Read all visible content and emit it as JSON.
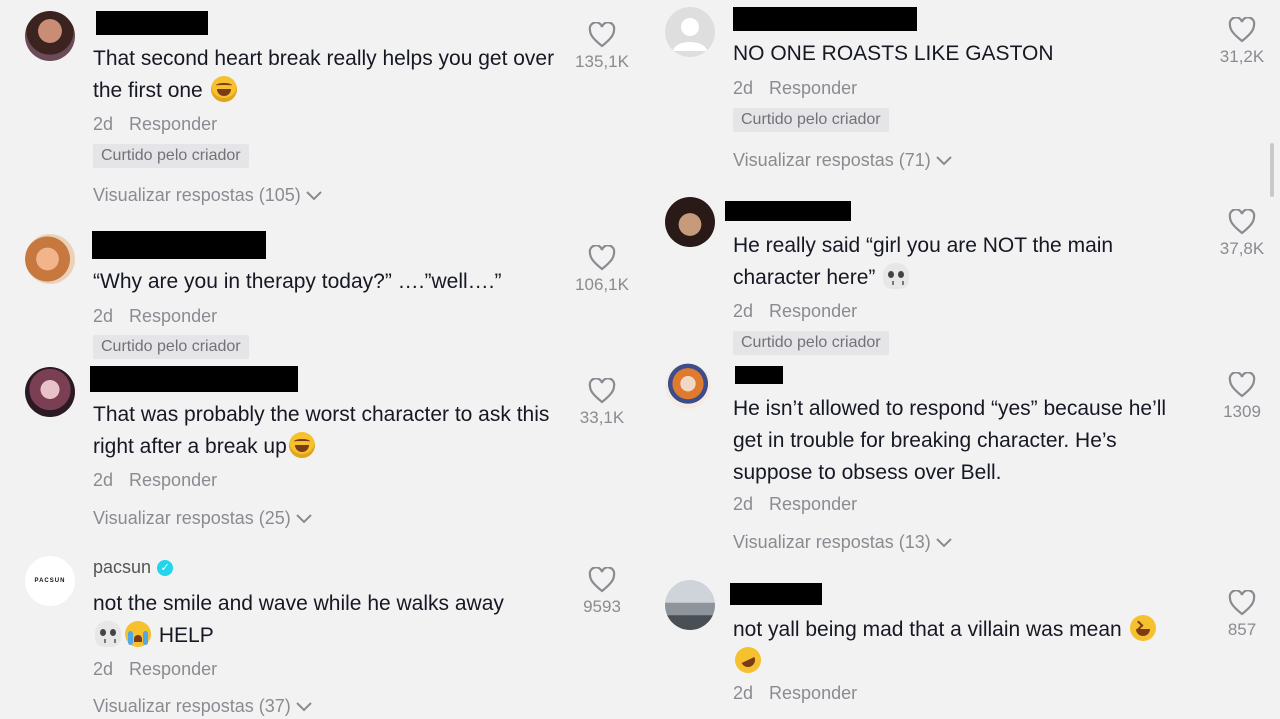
{
  "ui": {
    "reply_label": "Responder",
    "liked_by_creator": "Curtido pelo criador"
  },
  "comments_left": [
    {
      "text": "That second heart break really helps you get over the first one",
      "emoji": "laugh",
      "time": "2d",
      "likes": "135,1K",
      "view_replies": "Visualizar respostas (105)"
    },
    {
      "text": "“Why are you in therapy today?” ….”well….”",
      "time": "2d",
      "likes": "106,1K"
    },
    {
      "text": "That was probably the worst character to ask this right after a break up",
      "emoji": "laugh",
      "time": "2d",
      "likes": "33,1K",
      "view_replies": "Visualizar respostas (25)"
    },
    {
      "username": "pacsun",
      "avatar_text": "PACSUN",
      "text_line1": "not the smile and wave while he walks away",
      "text_line2": "HELP",
      "time": "2d",
      "likes": "9593",
      "view_replies": "Visualizar respostas (37)"
    }
  ],
  "comments_right": [
    {
      "text": "NO ONE ROASTS LIKE GASTON",
      "time": "2d",
      "likes": "31,2K",
      "view_replies": "Visualizar respostas (71)"
    },
    {
      "text": "He really said “girl you are NOT the main character here”",
      "emoji": "skull",
      "time": "2d",
      "likes": "37,8K"
    },
    {
      "text": "He isn’t allowed to respond “yes” because he’ll get in trouble for breaking character. He’s suppose to obsess over Bell.",
      "time": "2d",
      "likes": "1309",
      "view_replies": "Visualizar respostas (13)"
    },
    {
      "text": "not yall being mad that a villain was mean",
      "time": "2d",
      "likes": "857"
    }
  ],
  "colors": {
    "background": "#f3f2f3",
    "text": "#161823",
    "muted": "#8a8b91",
    "verified": "#20d5ec"
  }
}
